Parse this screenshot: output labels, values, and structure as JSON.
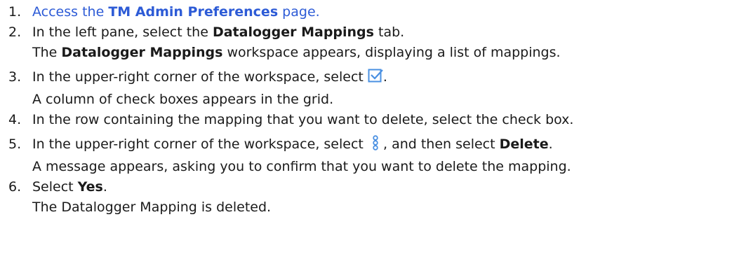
{
  "steps": [
    {
      "number": "1.",
      "prefix": "Access the ",
      "link_bold": "TM Admin Preferences",
      "suffix": " page."
    },
    {
      "number": "2.",
      "pre": "In the left pane, select the ",
      "bold": "Datalogger Mappings",
      "post": " tab.",
      "result_pre": "The ",
      "result_bold": "Datalogger Mappings",
      "result_post": " workspace appears, displaying a list of mappings."
    },
    {
      "number": "3.",
      "pre": "In the upper-right corner of the workspace, select ",
      "icon": "checkbox-select-icon",
      "post": ".",
      "result": "A column of check boxes appears in the grid."
    },
    {
      "number": "4.",
      "text": "In the row containing the mapping that you want to delete, select the check box."
    },
    {
      "number": "5.",
      "pre": "In the upper-right corner of the workspace, select ",
      "icon": "more-options-icon",
      "mid": ", and then select ",
      "bold": "Delete",
      "post": ".",
      "result": "A message appears, asking you to confirm that you want to delete the mapping."
    },
    {
      "number": "6.",
      "pre": "Select ",
      "bold": "Yes",
      "post": ".",
      "result": "The Datalogger Mapping is deleted."
    }
  ],
  "colors": {
    "link": "#2d5bd6",
    "icon": "#4a90e2",
    "text": "#1a1a1a"
  }
}
